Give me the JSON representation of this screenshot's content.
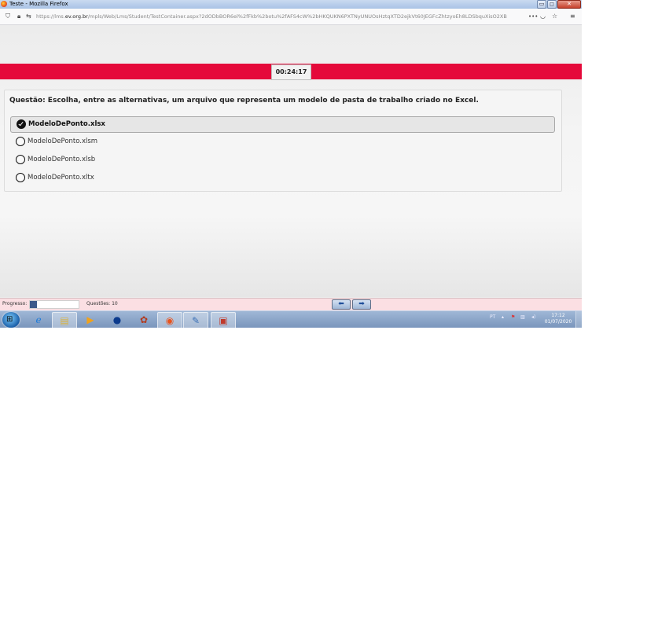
{
  "window": {
    "title": "Teste - Mozilla Firefox",
    "min_glyph": "▭",
    "max_glyph": "◻",
    "close_glyph": "✕"
  },
  "browser": {
    "url_prefix": "https://lms.",
    "url_domain": "ev.org.br",
    "url_rest": "/mpls/Web/Lms/Student/TestContainer.aspx?2dODbBOR6el%2fFkb%2botu%2fAFS4cW%2bHKQUKN6PXTNyUNUOsHztqXTD2ejkVt60JEGFcZhtzyoEh8LDSbquXisO2XB",
    "menu_glyph": "•••"
  },
  "test": {
    "timer": "00:24:17",
    "question": "Questão: Escolha, entre as alternativas, um arquivo que representa um modelo de pasta de trabalho criado no Excel.",
    "options": [
      {
        "label": "ModeloDePonto.xlsx",
        "selected": true
      },
      {
        "label": "ModeloDePonto.xlsm",
        "selected": false
      },
      {
        "label": "ModeloDePonto.xlsb",
        "selected": false
      },
      {
        "label": "ModeloDePonto.xltx",
        "selected": false
      }
    ]
  },
  "footer": {
    "progress_label": "Progresso:",
    "progress_fraction": 0.15,
    "progress_color": "#3c5a8a",
    "questions_label": "Questões: 10",
    "prev_glyph": "⬅",
    "next_glyph": "➡"
  },
  "taskbar": {
    "apps": [
      "ie-icon",
      "explorer-icon",
      "media-player-icon",
      "hp-icon",
      "app-icon",
      "firefox-icon",
      "paint-icon",
      "pdf-icon"
    ],
    "language": "PT",
    "time": "17:12",
    "date": "01/07/2020"
  },
  "colors": {
    "accent_bar": "#e5093a",
    "footer_bg": "#fbdfe3"
  }
}
